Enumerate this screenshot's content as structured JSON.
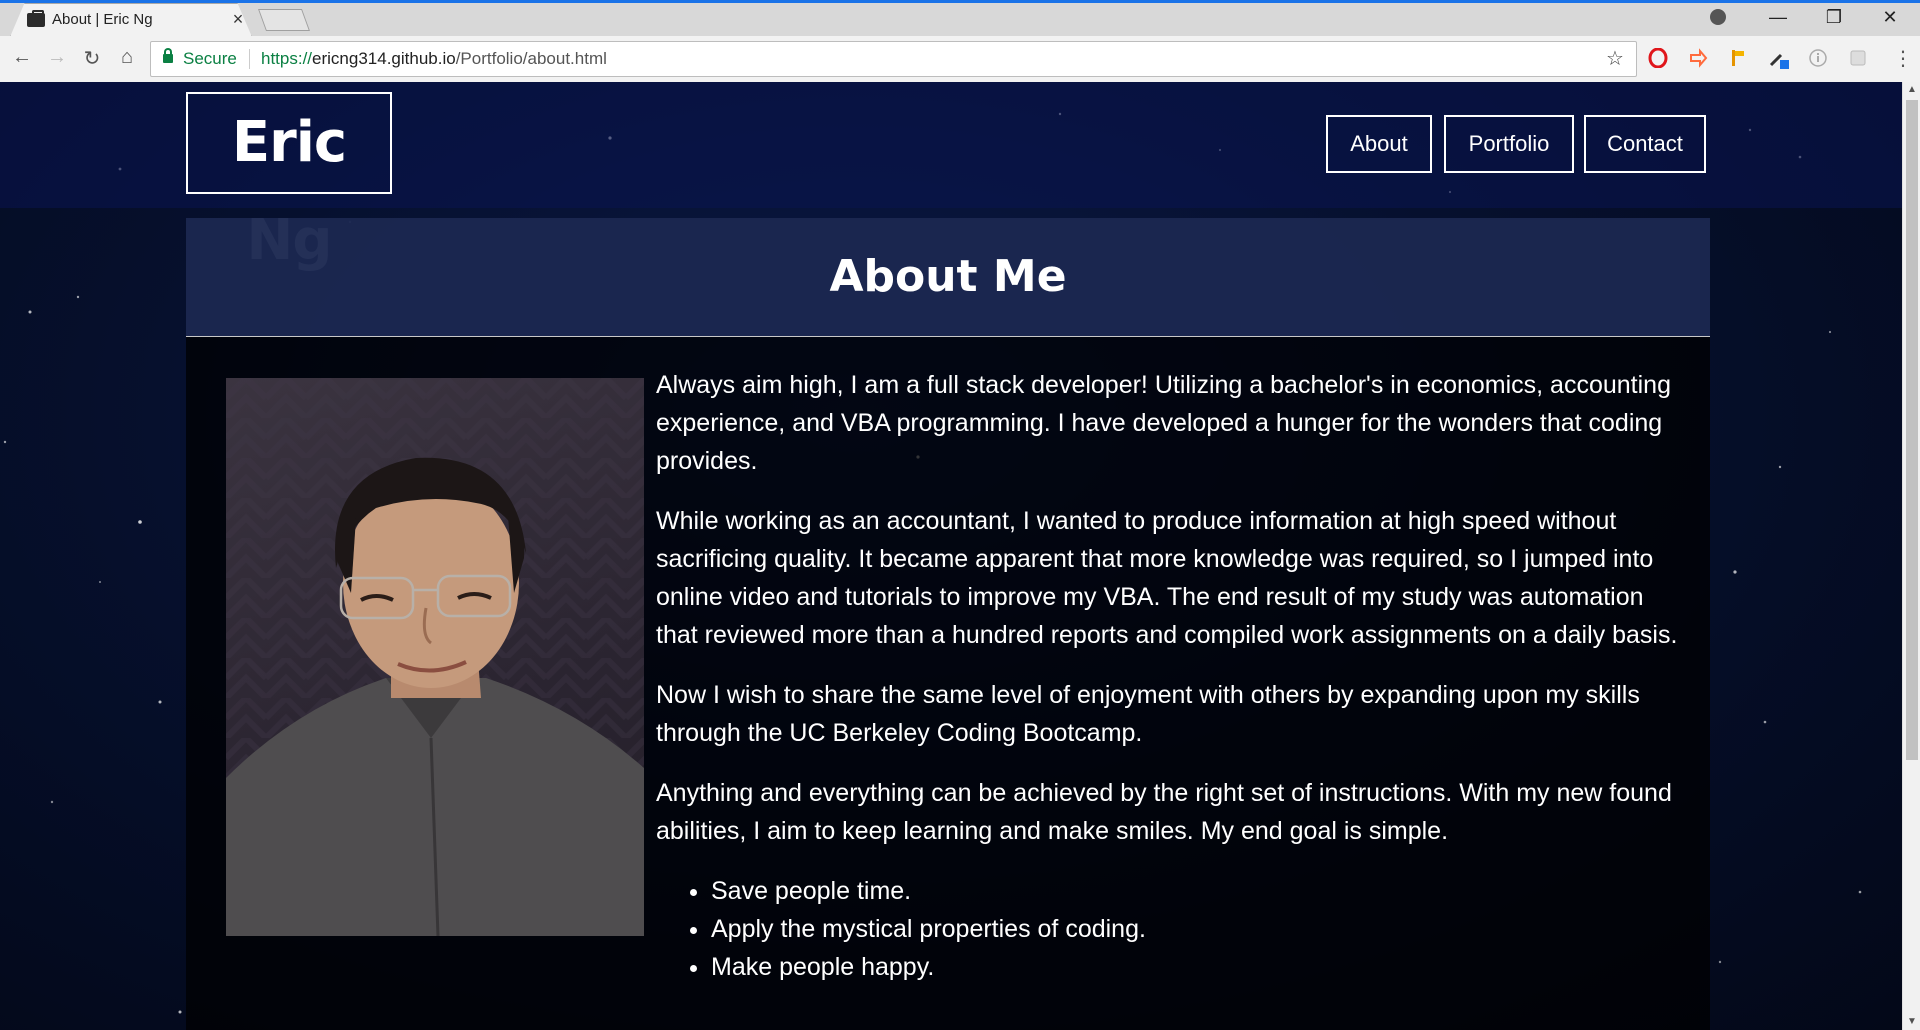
{
  "browser": {
    "tab_title": "About | Eric Ng",
    "tab_close": "×",
    "secure_label": "Secure",
    "url_scheme": "https://",
    "url_host": "ericng314.github.io",
    "url_path": "/Portfolio/about.html",
    "back_icon": "←",
    "forward_icon": "→",
    "reload_icon": "↻",
    "home_icon": "⌂",
    "star_icon": "☆",
    "menu_icon": "⋮",
    "minimize_icon": "—",
    "maximize_icon": "❐",
    "close_icon": "✕"
  },
  "site": {
    "logo": "Eric Ng",
    "nav": [
      {
        "label": "About"
      },
      {
        "label": "Portfolio"
      },
      {
        "label": "Contact"
      }
    ]
  },
  "about": {
    "title": "About Me",
    "paragraphs": [
      "Always aim high, I am a full stack developer! Utilizing a bachelor's in economics, accounting experience, and VBA programming. I have developed a hunger for the wonders that coding provides.",
      "While working as an accountant, I wanted to produce information at high speed without sacrificing quality. It became apparent that more knowledge was required, so I jumped into online video and tutorials to improve my VBA. The end result of my study was automation that reviewed more than a hundred reports and compiled work assignments on a daily basis.",
      "Now I wish to share the same level of enjoyment with others by expanding upon my skills through the UC Berkeley Coding Bootcamp.",
      "Anything and everything can be achieved by the right set of instructions. With my new found abilities, I aim to keep learning and make smiles. My end goal is simple."
    ],
    "goals": [
      "Save people time.",
      "Apply the mystical properties of coding.",
      "Make people happy."
    ]
  },
  "colors": {
    "accent": "#1a73e8",
    "secure_green": "#0b8043",
    "page_bg": "#06102e"
  }
}
